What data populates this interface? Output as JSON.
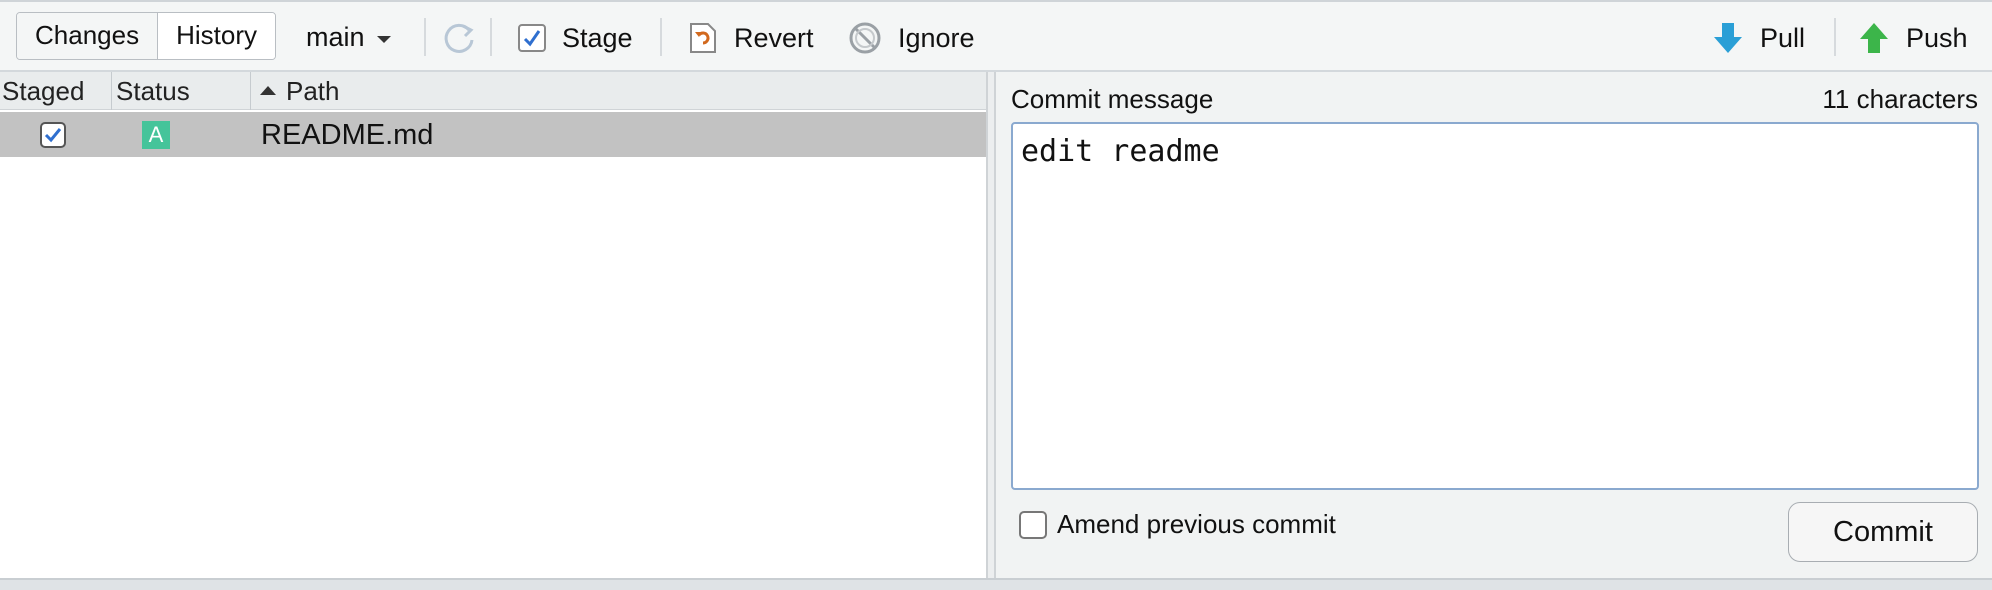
{
  "toolbar": {
    "tabs": [
      "Changes",
      "History"
    ],
    "branch": "main",
    "stage_label": "Stage",
    "revert_label": "Revert",
    "ignore_label": "Ignore",
    "pull_label": "Pull",
    "push_label": "Push"
  },
  "file_list": {
    "columns": [
      "Staged",
      "Status",
      "Path"
    ],
    "sort_column": "Path",
    "rows": [
      {
        "staged": true,
        "status": "A",
        "path": "README.md"
      }
    ]
  },
  "commit": {
    "label": "Commit message",
    "char_count": "11 characters",
    "message": "edit readme",
    "amend_label": "Amend previous commit",
    "amend_checked": false,
    "button_label": "Commit"
  },
  "colors": {
    "accent": "#4a90d9",
    "added_status": "#45c49a",
    "selected_row": "#c2c2c2",
    "pull_arrow": "#2a9fd6",
    "push_arrow": "#3cb54a",
    "revert_icon": "#d2691e"
  },
  "icons": [
    "refresh-icon",
    "stage-check-icon",
    "revert-icon",
    "ignore-icon",
    "pull-arrow-icon",
    "push-arrow-icon",
    "sort-up-icon"
  ]
}
